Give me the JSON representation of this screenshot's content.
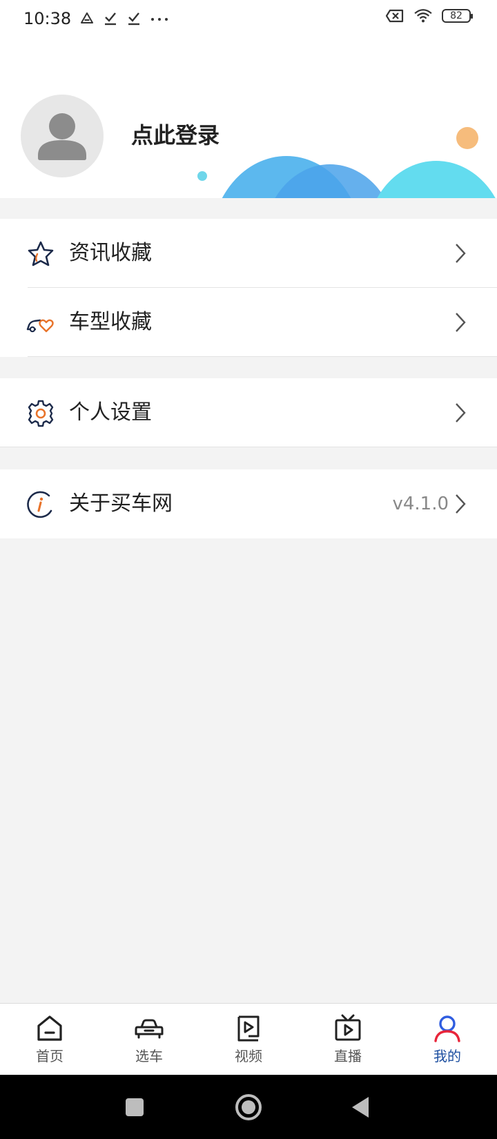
{
  "status_bar": {
    "time": "10:38",
    "battery": "82",
    "left_icons": [
      "drive-icon",
      "download-done-icon",
      "download-done-icon",
      "more-dots-icon"
    ],
    "right_icons": [
      "no-sim-icon",
      "wifi-icon",
      "battery-icon"
    ]
  },
  "profile": {
    "login_text": "点此登录",
    "avatar_icon": "default-user-avatar-icon"
  },
  "menu": {
    "news_favorites": {
      "label": "资讯收藏",
      "icon": "star-icon"
    },
    "car_favorites": {
      "label": "车型收藏",
      "icon": "car-heart-icon"
    },
    "settings": {
      "label": "个人设置",
      "icon": "gear-icon"
    },
    "about": {
      "label": "关于买车网",
      "value": "v4.1.0",
      "icon": "info-icon"
    }
  },
  "tabbar": {
    "tabs": [
      {
        "label": "首页",
        "icon": "home-icon"
      },
      {
        "label": "选车",
        "icon": "car-icon"
      },
      {
        "label": "视频",
        "icon": "video-icon"
      },
      {
        "label": "直播",
        "icon": "tv-icon"
      },
      {
        "label": "我的",
        "icon": "user-icon",
        "active": true
      }
    ]
  },
  "colors": {
    "accent_blue": "#1d4fa0",
    "icon_navy": "#1c2a4a",
    "icon_orange": "#e8732a",
    "active_red": "#e8253a",
    "active_blue": "#2f5de0",
    "background": "#f3f3f3"
  }
}
